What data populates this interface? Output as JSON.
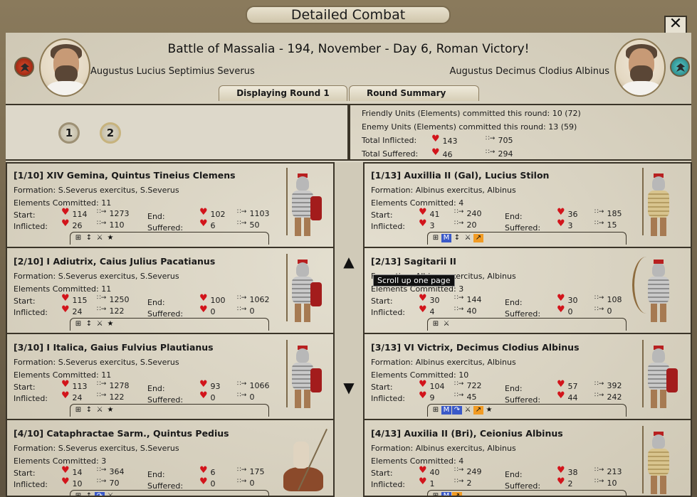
{
  "window": {
    "title": "Detailed Combat",
    "close_label": "✕"
  },
  "header": {
    "battle_title": "Battle of Massalia - 194, November - Day 6, Roman Victory!",
    "left_commander": "Augustus Lucius Septimius Severus",
    "right_commander": "Augustus Decimus Clodius Albinus"
  },
  "tabs": [
    {
      "label": "Displaying Round 1"
    },
    {
      "label": "Round Summary"
    }
  ],
  "rounds": [
    "1",
    "2"
  ],
  "summary": {
    "friendly": "Friendly Units (Elements) committed this round: 10 (72)",
    "enemy": "Enemy Units (Elements) committed this round: 13 (59)",
    "inflicted_label": "Total Inflicted:",
    "inflicted_hp": "143",
    "inflicted_men": "705",
    "suffered_label": "Total Suffered:",
    "suffered_hp": "46",
    "suffered_men": "294"
  },
  "labels": {
    "start": "Start:",
    "inflicted": "Inflicted:",
    "end": "End:",
    "suffered": "Suffered:"
  },
  "tooltip": "Scroll up one page",
  "left_units": [
    {
      "name": "[1/10] XIV Gemina, Quintus Tineius Clemens",
      "formation": "Formation: S.Severus exercitus, S.Severus",
      "elements": "Elements Committed: 11",
      "start_hp": "114",
      "start_men": "1273",
      "infl_hp": "26",
      "infl_men": "110",
      "end_hp": "102",
      "end_men": "1103",
      "suff_hp": "6",
      "suff_men": "50",
      "abilities": [
        "grid-icon",
        "arrow-icon",
        "sword-icon",
        "medal-icon"
      ]
    },
    {
      "name": "[2/10] I Adiutrix, Caius Julius Pacatianus",
      "formation": "Formation: S.Severus exercitus, S.Severus",
      "elements": "Elements Committed: 11",
      "start_hp": "115",
      "start_men": "1250",
      "infl_hp": "24",
      "infl_men": "122",
      "end_hp": "100",
      "end_men": "1062",
      "suff_hp": "0",
      "suff_men": "0",
      "abilities": [
        "grid-icon",
        "arrow-icon",
        "sword-icon",
        "medal-icon"
      ]
    },
    {
      "name": "[3/10] I Italica, Gaius Fulvius Plautianus",
      "formation": "Formation: S.Severus exercitus, S.Severus",
      "elements": "Elements Committed: 11",
      "start_hp": "113",
      "start_men": "1278",
      "infl_hp": "24",
      "infl_men": "122",
      "end_hp": "93",
      "end_men": "1066",
      "suff_hp": "0",
      "suff_men": "0",
      "abilities": [
        "grid-icon",
        "arrow-icon",
        "sword-icon",
        "medal-icon"
      ]
    },
    {
      "name": "[4/10] Cataphractae Sarm., Quintus Pedius",
      "formation": "Formation: S.Severus exercitus, S.Severus",
      "elements": "Elements Committed: 3",
      "start_hp": "14",
      "start_men": "364",
      "infl_hp": "10",
      "infl_men": "70",
      "end_hp": "6",
      "end_men": "175",
      "suff_hp": "0",
      "suff_men": "0",
      "abilities": [
        "grid-icon",
        "arrow-icon",
        "charge-icon",
        "sword-icon"
      ]
    }
  ],
  "right_units": [
    {
      "name": "[1/13] Auxillia II (Gal), Lucius Stilon",
      "formation": "Formation: Albinus exercitus, Albinus",
      "elements": "Elements Committed: 4",
      "start_hp": "41",
      "start_men": "240",
      "infl_hp": "3",
      "infl_men": "20",
      "end_hp": "36",
      "end_men": "185",
      "suff_hp": "3",
      "suff_men": "15",
      "abilities": [
        "grid-icon",
        "m-icon",
        "arrow-icon",
        "sword-icon",
        "run-icon"
      ]
    },
    {
      "name": "[2/13] Sagitarii II",
      "formation": "Formation: Albinus exercitus, Albinus",
      "elements": "Elements Committed: 3",
      "start_hp": "30",
      "start_men": "144",
      "infl_hp": "4",
      "infl_men": "40",
      "end_hp": "30",
      "end_men": "108",
      "suff_hp": "0",
      "suff_men": "0",
      "abilities": [
        "grid-icon",
        "sword-icon"
      ]
    },
    {
      "name": "[3/13] VI Victrix, Decimus Clodius Albinus",
      "formation": "Formation: Albinus exercitus, Albinus",
      "elements": "Elements Committed: 10",
      "start_hp": "104",
      "start_men": "722",
      "infl_hp": "9",
      "infl_men": "45",
      "end_hp": "57",
      "end_men": "392",
      "suff_hp": "44",
      "suff_men": "242",
      "abilities": [
        "grid-icon",
        "m-icon",
        "charge-icon",
        "sword-icon",
        "run-icon",
        "medal-icon"
      ]
    },
    {
      "name": "[4/13] Auxilia II (Bri), Ceionius Albinus",
      "formation": "Formation: Albinus exercitus, Albinus",
      "elements": "Elements Committed: 4",
      "start_hp": "40",
      "start_men": "249",
      "infl_hp": "1",
      "infl_men": "2",
      "end_hp": "38",
      "end_men": "213",
      "suff_hp": "2",
      "suff_men": "10",
      "abilities": [
        "grid-icon",
        "m-icon",
        "run-icon"
      ]
    }
  ]
}
